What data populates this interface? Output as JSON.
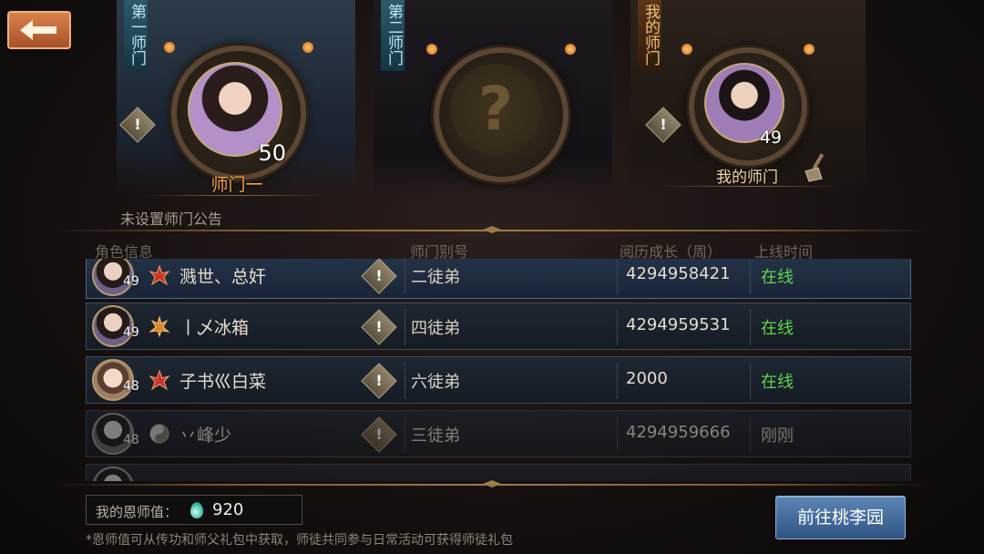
{
  "slots": [
    {
      "tag": "第一师门",
      "name": "师门一",
      "level": "50",
      "filled": true
    },
    {
      "tag": "第二师门",
      "name": "",
      "level": "",
      "filled": false
    },
    {
      "tag": "我的师门",
      "name": "我的师门",
      "level": "49",
      "filled": true
    }
  ],
  "notice": "未设置师门公告",
  "columns": {
    "info": "角色信息",
    "alias": "师门别号",
    "growth": "阅历成长（周）",
    "online": "上线时间"
  },
  "members": [
    {
      "level": "49",
      "name": "溅世、总奸",
      "alias": "二徒弟",
      "growth": "4294958421",
      "status": "在线",
      "online": true
    },
    {
      "level": "49",
      "name": "丨乄冰箱",
      "alias": "四徒弟",
      "growth": "4294959531",
      "status": "在线",
      "online": true
    },
    {
      "level": "48",
      "name": "子书巛白菜",
      "alias": "六徒弟",
      "growth": "2000",
      "status": "在线",
      "online": true
    },
    {
      "level": "48",
      "name": "丷峰少",
      "alias": "三徒弟",
      "growth": "4294959666",
      "status": "刚刚",
      "online": false
    }
  ],
  "mentor": {
    "label": "我的恩师值：",
    "value": "920"
  },
  "footnote": "*恩师值可从传功和师父礼包中获取，师徒共同参与日常活动可获得师徒礼包",
  "go_button": "前往桃李园",
  "colors": {
    "online": "#5fd64b",
    "accent": "#f6a33a",
    "button": "#3f6a9d"
  }
}
